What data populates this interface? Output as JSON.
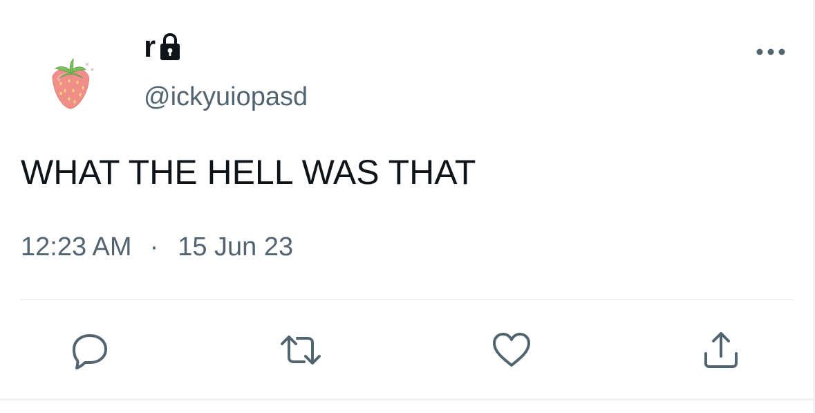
{
  "author": {
    "display_name": "r",
    "handle": "@ickyuiopasd",
    "protected": true,
    "avatar_icon": "strawberry-icon"
  },
  "tweet": {
    "text": "WHAT THE HELL WAS THAT",
    "time": "12:23 AM",
    "separator": "·",
    "date": "15 Jun 23"
  },
  "actions": [
    {
      "name": "reply",
      "icon": "reply-icon"
    },
    {
      "name": "retweet",
      "icon": "retweet-icon"
    },
    {
      "name": "like",
      "icon": "heart-icon"
    },
    {
      "name": "share",
      "icon": "share-icon"
    }
  ],
  "colors": {
    "text_primary": "#0f1419",
    "text_secondary": "#536471",
    "divider": "#eff3f4",
    "icon": "#536471"
  }
}
